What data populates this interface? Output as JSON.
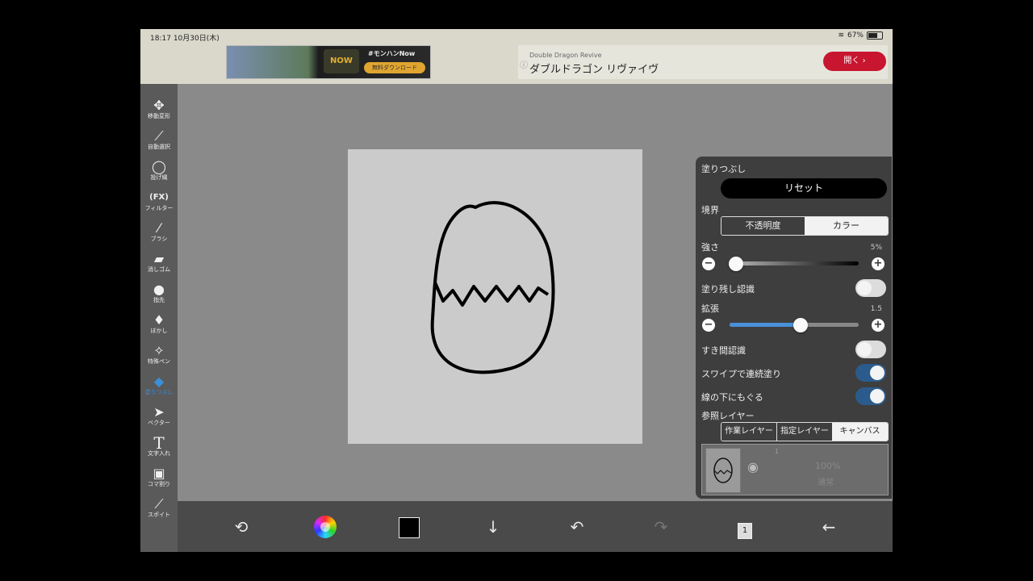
{
  "status": {
    "time": "18:17",
    "date": "10月30日(木)",
    "battery": "67%"
  },
  "ads": {
    "left_tag": "#モンハンNow",
    "left_logo": "NOW",
    "left_cta": "無料ダウンロード",
    "right_sub": "Double Dragon Revive",
    "right_title": "ダブルドラゴン リヴァイヴ",
    "right_button": "開く ›"
  },
  "toolbar": {
    "items": [
      {
        "label": "移動変形",
        "icon": "move-icon"
      },
      {
        "label": "自動選択",
        "icon": "magic-wand-icon"
      },
      {
        "label": "投げ縄",
        "icon": "lasso-icon"
      },
      {
        "label": "フィルター",
        "icon": "fx-icon"
      },
      {
        "label": "ブラシ",
        "icon": "brush-icon"
      },
      {
        "label": "消しゴム",
        "icon": "eraser-icon"
      },
      {
        "label": "指先",
        "icon": "finger-icon"
      },
      {
        "label": "ぼかし",
        "icon": "blur-drop-icon"
      },
      {
        "label": "特殊ペン",
        "icon": "special-pen-icon"
      },
      {
        "label": "塗りつぶし",
        "icon": "fill-bucket-icon",
        "active": true
      },
      {
        "label": "ベクター",
        "icon": "vector-arrow-icon"
      },
      {
        "label": "文字入れ",
        "icon": "text-icon"
      },
      {
        "label": "コマ割り",
        "icon": "frame-icon"
      },
      {
        "label": "スポイト",
        "icon": "eyedropper-icon"
      }
    ]
  },
  "fill_panel": {
    "title": "塗りつぶし",
    "reset": "リセット",
    "boundary_label": "境界",
    "boundary_options": [
      "不透明度",
      "カラー"
    ],
    "boundary_selected": "カラー",
    "strength_label": "強さ",
    "strength_value": "5%",
    "strength_fraction": 0.05,
    "leftover_label": "塗り残し認識",
    "leftover_on": false,
    "expand_label": "拡張",
    "expand_value": "1.5",
    "expand_fraction": 0.55,
    "gap_label": "すき間認識",
    "gap_on": false,
    "swipe_label": "スワイプで連続塗り",
    "swipe_on": true,
    "under_line_label": "線の下にもぐる",
    "under_line_on": true,
    "ref_layer_label": "参照レイヤー",
    "ref_options": [
      "作業レイヤー",
      "指定レイヤー",
      "キャンバス"
    ],
    "ref_selected": "キャンバス"
  },
  "layer": {
    "number": "1",
    "opacity": "100%",
    "mode": "通常"
  },
  "bottom": {
    "page_count": "1"
  }
}
